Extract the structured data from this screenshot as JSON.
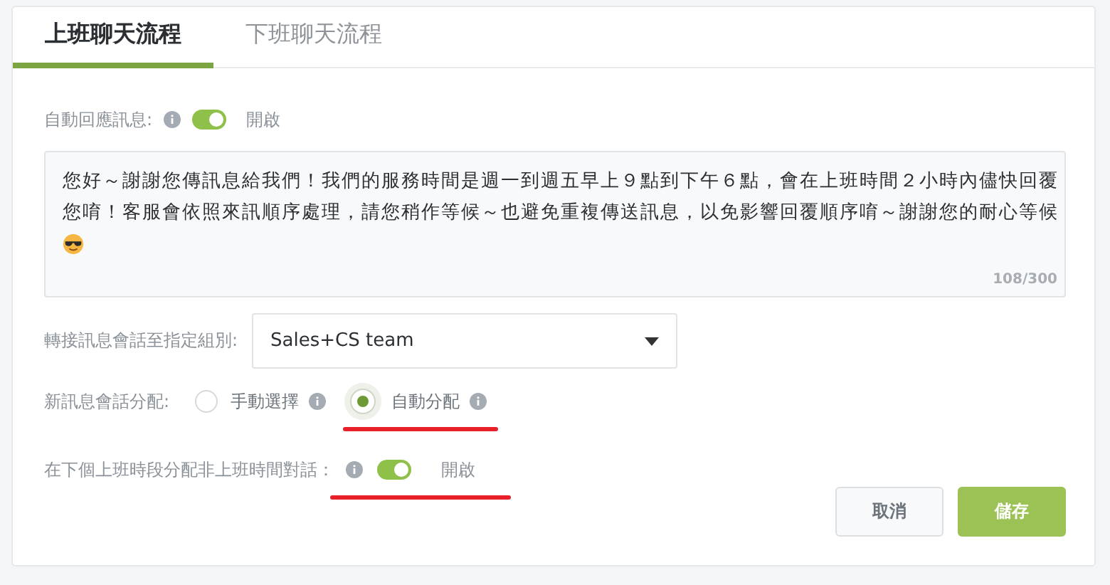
{
  "tabs": [
    {
      "label": "上班聊天流程",
      "selected": true
    },
    {
      "label": "下班聊天流程",
      "selected": false
    }
  ],
  "auto_reply": {
    "label": "自動回應訊息:",
    "on": true,
    "state_label": "開啟"
  },
  "message": {
    "value": "您好～謝謝您傳訊息給我們！我們的服務時間是週一到週五早上９點到下午６點，會在上班時間２小時內儘快回覆您唷！客服會依照來訊順序處理，請您稍作等候～也避免重複傳送訊息，以免影響回覆順序唷～謝謝您的耐心等候",
    "counter": "108/300"
  },
  "transfer": {
    "label": "轉接訊息會話至指定組別:",
    "value": "Sales+CS team"
  },
  "assignment": {
    "label": "新訊息會話分配:",
    "options": [
      {
        "label": "手動選擇",
        "selected": false,
        "annotated": false
      },
      {
        "label": "自動分配",
        "selected": true,
        "annotated": true
      }
    ]
  },
  "off_hours": {
    "label": "在下個上班時段分配非上班時間對話：",
    "on": true,
    "state_label": "開啟",
    "annotated": true
  },
  "buttons": [
    {
      "label": "取消",
      "kind": "secondary"
    },
    {
      "label": "儲存",
      "kind": "primary"
    }
  ]
}
